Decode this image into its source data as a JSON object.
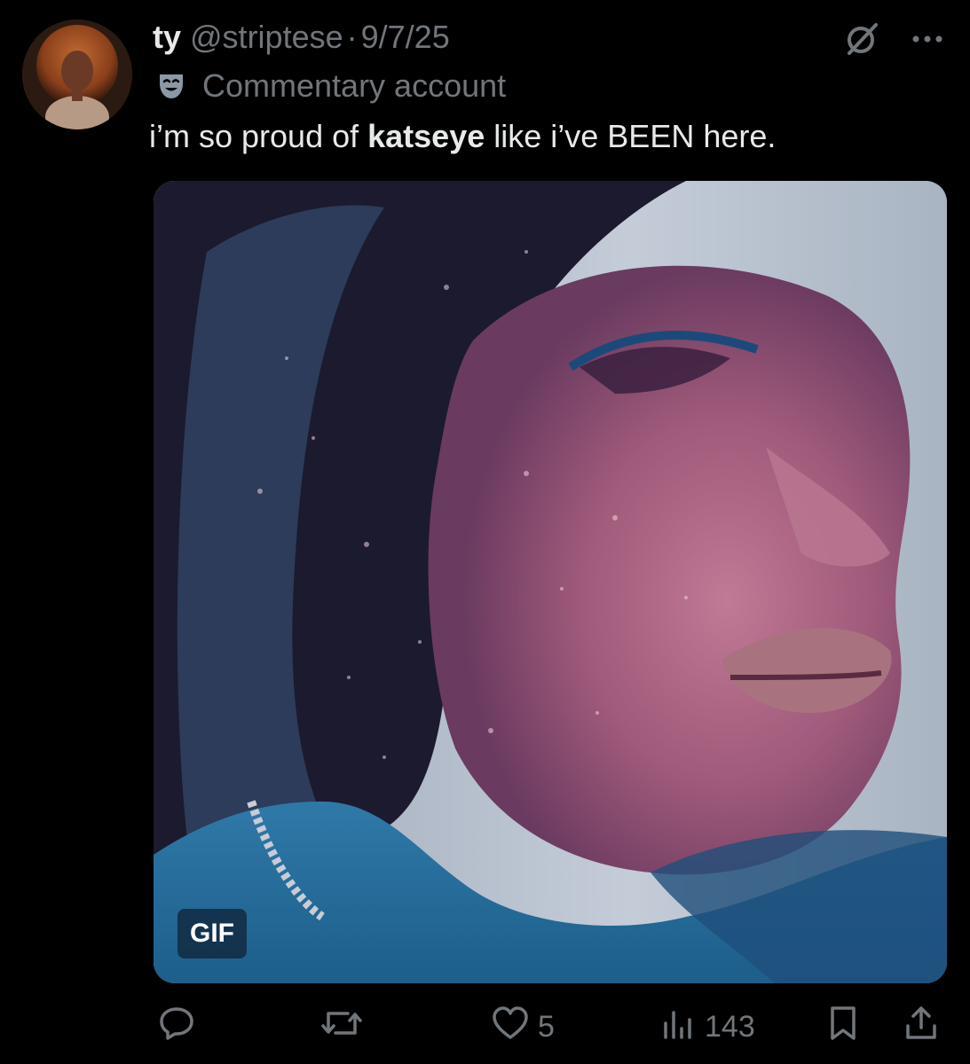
{
  "tweet": {
    "display_name": "ty",
    "handle": "@striptese",
    "separator": "·",
    "date": "9/7/25",
    "account_label": "Commentary account",
    "text_before": "i’m so proud of ",
    "text_bold": "katseye",
    "text_after": " like i’ve BEEN here.",
    "media_badge": "GIF"
  },
  "actions": {
    "reply_count": "",
    "retweet_count": "",
    "like_count": "5",
    "views_count": "143"
  },
  "icons": {
    "top": [
      "grok-icon",
      "more-icon"
    ],
    "label": "theater-mask-icon",
    "action_bar": [
      "reply-icon",
      "retweet-icon",
      "like-icon",
      "views-icon",
      "bookmark-icon",
      "share-icon"
    ]
  },
  "colors": {
    "background": "#000000",
    "primary_text": "#e7e9ea",
    "secondary_text": "#71767b",
    "gif_badge_bg": "#122a42"
  }
}
